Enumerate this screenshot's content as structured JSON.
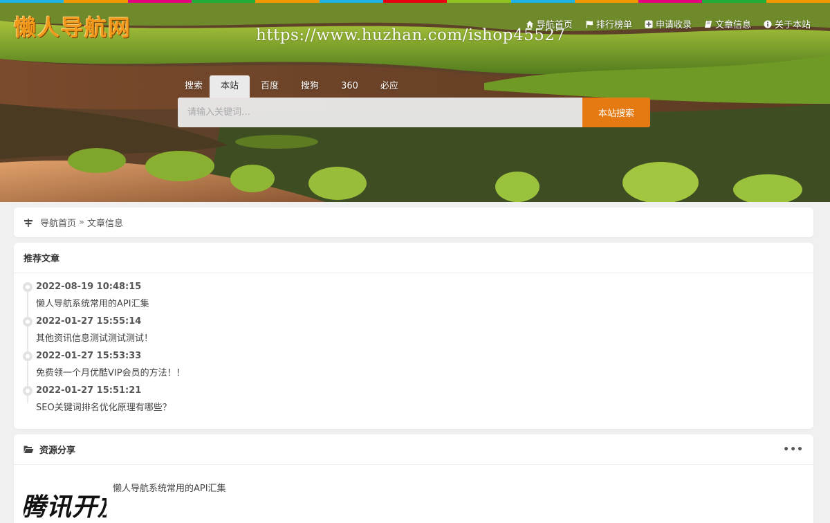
{
  "header": {
    "logo": "懒人导航网",
    "watermark": "https://www.huzhan.com/ishop45527",
    "topbar_colors": [
      "#1bb3e8",
      "#f39800",
      "#e4007f",
      "#22ac38",
      "#f39800",
      "#1bb3e8",
      "#e60012",
      "#8fc31f",
      "#1bb3e8",
      "#f39800",
      "#e4007f",
      "#22ac38",
      "#f39800"
    ],
    "nav": [
      {
        "label": "导航首页",
        "icon": "home-icon"
      },
      {
        "label": "排行榜单",
        "icon": "flag-icon"
      },
      {
        "label": "申请收录",
        "icon": "plus-square-icon"
      },
      {
        "label": "文章信息",
        "icon": "book-icon"
      },
      {
        "label": "关于本站",
        "icon": "info-circle-icon"
      }
    ]
  },
  "search": {
    "label": "搜索",
    "tabs": [
      "本站",
      "百度",
      "搜狗",
      "360",
      "必应"
    ],
    "active_tab": "本站",
    "placeholder": "请输入关键词…",
    "button": "本站搜索"
  },
  "breadcrumb": {
    "icon": "signpost-icon",
    "home": "导航首页",
    "separator": "»",
    "current": "文章信息"
  },
  "recommended": {
    "title": "推荐文章",
    "items": [
      {
        "time": "2022-08-19 10:48:15",
        "title": "懒人导航系统常用的API汇集"
      },
      {
        "time": "2022-01-27 15:55:14",
        "title": "其他资讯信息测试测试测试！"
      },
      {
        "time": "2022-01-27 15:53:33",
        "title": "免费领一个月优酷VIP会员的方法！！"
      },
      {
        "time": "2022-01-27 15:51:21",
        "title": "SEO关键词排名优化原理有哪些？"
      }
    ]
  },
  "resources": {
    "title": "资源分享",
    "icon": "folder-open-icon",
    "more": "•••",
    "thumb_text": "腾讯开放",
    "item_title": "懒人导航系统常用的API汇集"
  },
  "colors": {
    "accent": "#e57a12",
    "logo": "#f29a1c"
  }
}
